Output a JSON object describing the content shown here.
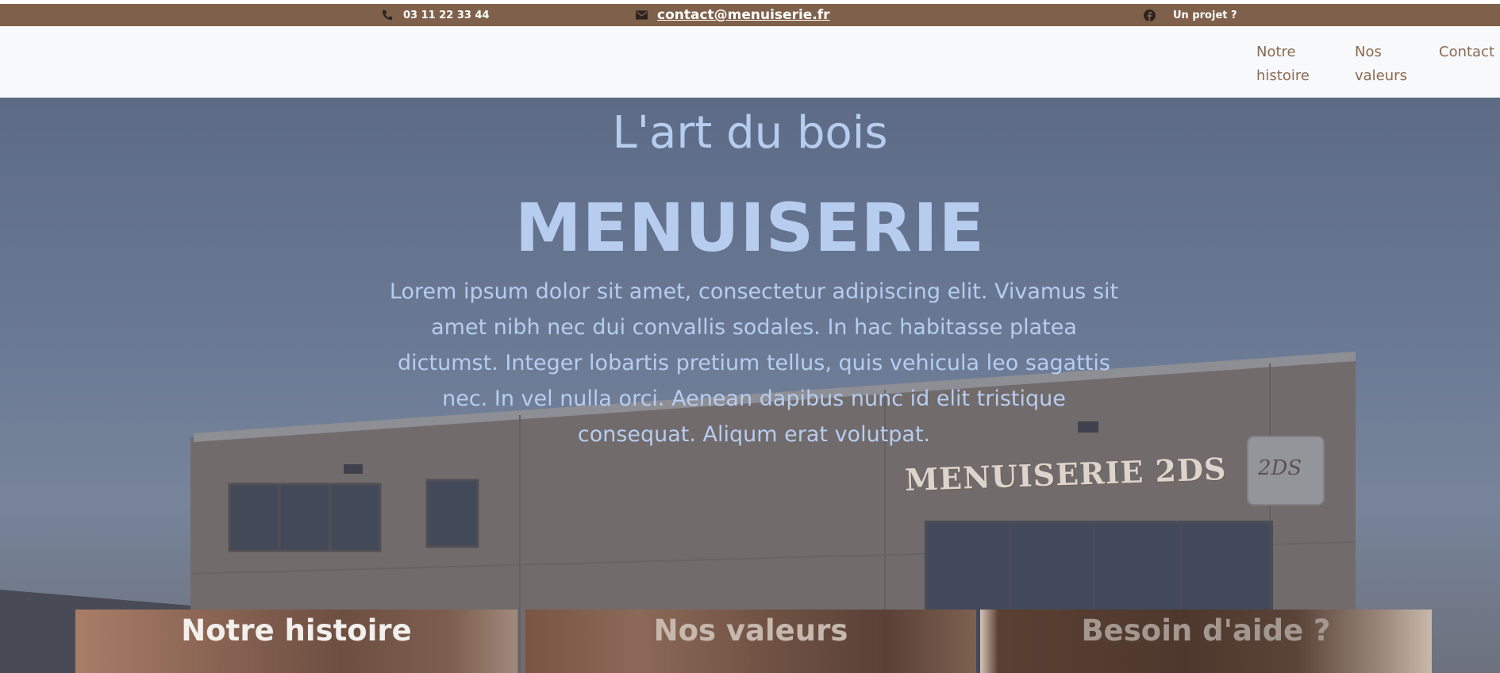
{
  "topbar": {
    "phone": "03 11 22 33 44",
    "email": "contact@menuiserie.fr",
    "project": "Un projet ?",
    "icons": {
      "phone": "phone-icon",
      "email": "envelope-icon",
      "social": "facebook-icon"
    },
    "background": "#7f604a"
  },
  "nav": {
    "items": [
      {
        "line1": "Notre",
        "line2": "histoire"
      },
      {
        "line1": "Nos",
        "line2": "valeurs"
      },
      {
        "line1": "Contact",
        "line2": ""
      }
    ],
    "color": "#8a6a52"
  },
  "hero": {
    "subtitle": "L'art du bois",
    "title": "MENUISERIE",
    "text": "Lorem ipsum dolor sit amet, consectetur adipiscing elit. Vivamus sit amet nibh nec dui convallis sodales. In hac habitasse platea dictumst. Integer lobartis pretium tellus, quis vehicula leo sagattis nec. In vel nulla orci. Aenean dapibus nunc id elit tristique consequat. Aliqum erat volutpat.",
    "building_sign": "MENUISERIE 2DS",
    "logo_text": "2DS",
    "text_color": "#b6cdf0"
  },
  "cards": [
    {
      "title": "Notre histoire"
    },
    {
      "title": "Nos valeurs"
    },
    {
      "title": "Besoin d'aide ?"
    }
  ]
}
